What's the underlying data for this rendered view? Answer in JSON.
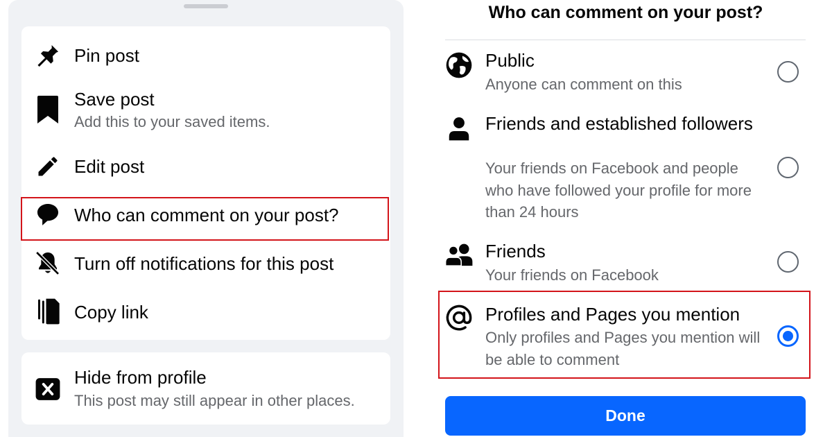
{
  "left_menu": {
    "items": [
      {
        "label": "Pin post",
        "icon": "pin-icon"
      },
      {
        "label": "Save post",
        "sublabel": "Add this to your saved items.",
        "icon": "bookmark-icon"
      },
      {
        "label": "Edit post",
        "icon": "pencil-icon"
      },
      {
        "label": "Who can comment on your post?",
        "icon": "comment-bubble-icon"
      },
      {
        "label": "Turn off notifications for this post",
        "icon": "bell-off-icon"
      },
      {
        "label": "Copy link",
        "icon": "copy-link-icon"
      }
    ],
    "hide": {
      "label": "Hide from profile",
      "sublabel": "This post may still appear in other places.",
      "icon": "close-box-icon"
    }
  },
  "comment_dialog": {
    "title": "Who can comment on your post?",
    "options": [
      {
        "label": "Public",
        "description": "Anyone can comment on this",
        "icon": "globe-icon",
        "selected": false
      },
      {
        "label": "Friends and established followers",
        "description": "Your friends on Facebook and people who have followed your profile for more than 24 hours",
        "icon": "person-icon",
        "selected": false
      },
      {
        "label": "Friends",
        "description": "Your friends on Facebook",
        "icon": "friends-icon",
        "selected": false
      },
      {
        "label": "Profiles and Pages you mention",
        "description": "Only profiles and Pages you mention will be able to comment",
        "icon": "at-sign-icon",
        "selected": true
      }
    ],
    "done_label": "Done"
  },
  "colors": {
    "accent": "#0866ff",
    "highlight_box": "#d3141a",
    "sheet_background": "#f0f2f5",
    "secondary_text": "#65676b"
  }
}
